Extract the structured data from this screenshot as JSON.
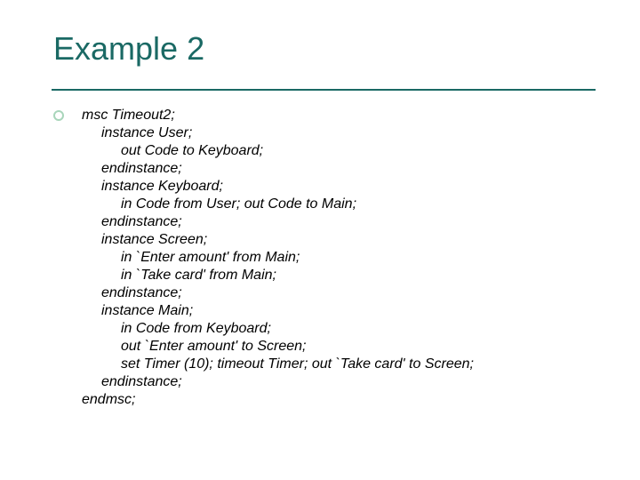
{
  "slide": {
    "title": "Example 2",
    "lines": [
      {
        "indent": 0,
        "text": "msc Timeout2;"
      },
      {
        "indent": 1,
        "text": "instance User;"
      },
      {
        "indent": 2,
        "text": "out Code to Keyboard;"
      },
      {
        "indent": 1,
        "text": "endinstance;"
      },
      {
        "indent": 1,
        "text": "instance Keyboard;"
      },
      {
        "indent": 2,
        "text": "in Code from User; out Code to Main;"
      },
      {
        "indent": 1,
        "text": "endinstance;"
      },
      {
        "indent": 1,
        "text": "instance Screen;"
      },
      {
        "indent": 2,
        "text": "in `Enter amount' from Main;"
      },
      {
        "indent": 2,
        "text": "in `Take card' from Main;"
      },
      {
        "indent": 1,
        "text": "endinstance;"
      },
      {
        "indent": 1,
        "text": "instance Main;"
      },
      {
        "indent": 2,
        "text": "in Code from Keyboard;"
      },
      {
        "indent": 2,
        "text": "out `Enter amount' to Screen;"
      },
      {
        "indent": 2,
        "text": "set Timer (10); timeout Timer; out `Take card' to Screen;"
      },
      {
        "indent": 1,
        "text": "endinstance;"
      },
      {
        "indent": 0,
        "text": "endmsc;"
      }
    ]
  }
}
